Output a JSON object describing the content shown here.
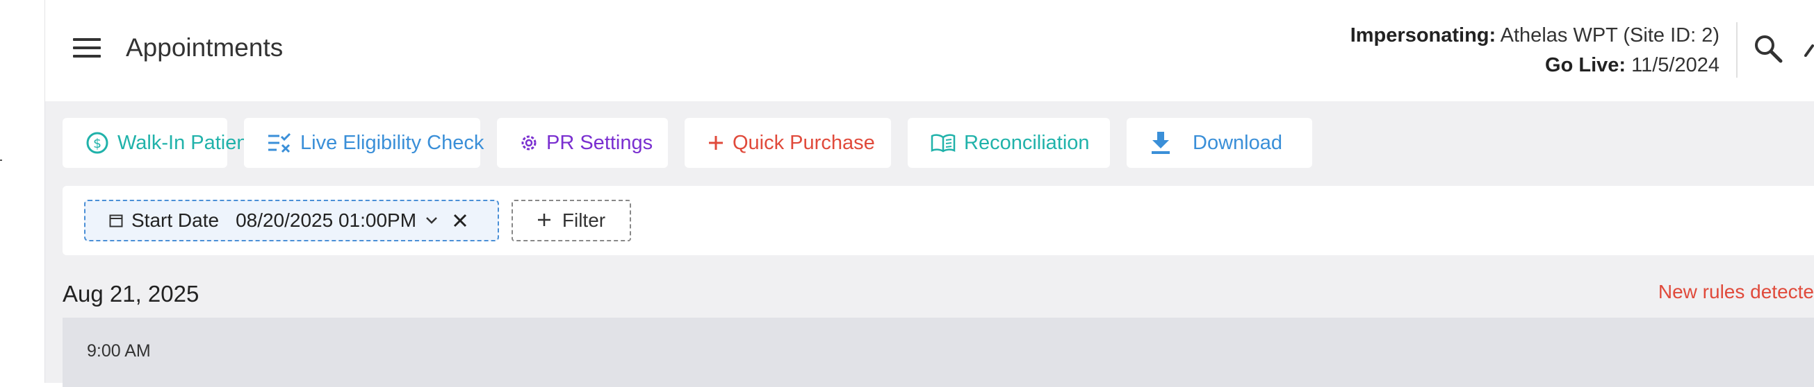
{
  "header": {
    "title": "Appointments",
    "impersonating_label": "Impersonating:",
    "impersonating_value": "Athelas WPT (Site ID: 2)",
    "golive_label": "Go Live:",
    "golive_value": "11/5/2024"
  },
  "toolbar": {
    "buttons": [
      {
        "label": "Walk-In Patient",
        "icon": "dollar-circle-icon",
        "color": "#20b2aa"
      },
      {
        "label": "Live Eligibility Check",
        "icon": "checklist-icon",
        "color": "#3a8fd8"
      },
      {
        "label": "PR Settings",
        "icon": "gear-icon",
        "color": "#7a2fd0"
      },
      {
        "label": "Quick Purchase",
        "icon": "plus-icon",
        "color": "#e04a3b"
      },
      {
        "label": "Reconciliation",
        "icon": "open-book-icon",
        "color": "#20b2aa"
      },
      {
        "label": "Download",
        "icon": "download-icon",
        "color": "#3a8fd8"
      }
    ]
  },
  "filters": {
    "start_date_label": "Start Date",
    "start_date_value": "08/20/2025 01:00PM",
    "add_filter_label": "Filter"
  },
  "schedule": {
    "date_heading": "Aug 21, 2025",
    "rules_notice": "New rules detecte",
    "time_slot": "9:00 AM"
  },
  "colors": {
    "accent_blue": "#4a8fd6",
    "alert_red": "#e04a3b",
    "background_gray": "#f0f0f2"
  }
}
